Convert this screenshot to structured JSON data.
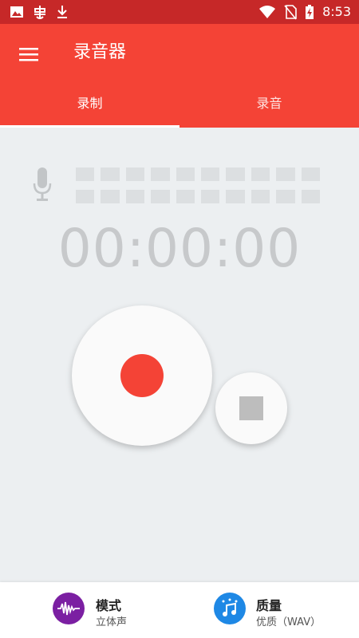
{
  "status_bar": {
    "time": "8:53",
    "icons": [
      "image-icon",
      "bug-icon",
      "download-icon",
      "wifi-icon",
      "no-sim-icon",
      "battery-charging-icon"
    ]
  },
  "app_bar": {
    "title": "录音器",
    "tabs": [
      {
        "label": "录制",
        "selected": true
      },
      {
        "label": "录音",
        "selected": false
      }
    ]
  },
  "recorder": {
    "timer": "00:00:00",
    "level_rows": 2,
    "level_columns": 10
  },
  "bottom": {
    "mode": {
      "title": "模式",
      "value": "立体声"
    },
    "quality": {
      "title": "质量",
      "value": "优质（WAV）"
    }
  },
  "colors": {
    "status_bar": "#c62828",
    "app_bar": "#f44336",
    "record": "#f44336",
    "mode_icon": "#7b1fa2",
    "quality_icon": "#1e88e5"
  }
}
